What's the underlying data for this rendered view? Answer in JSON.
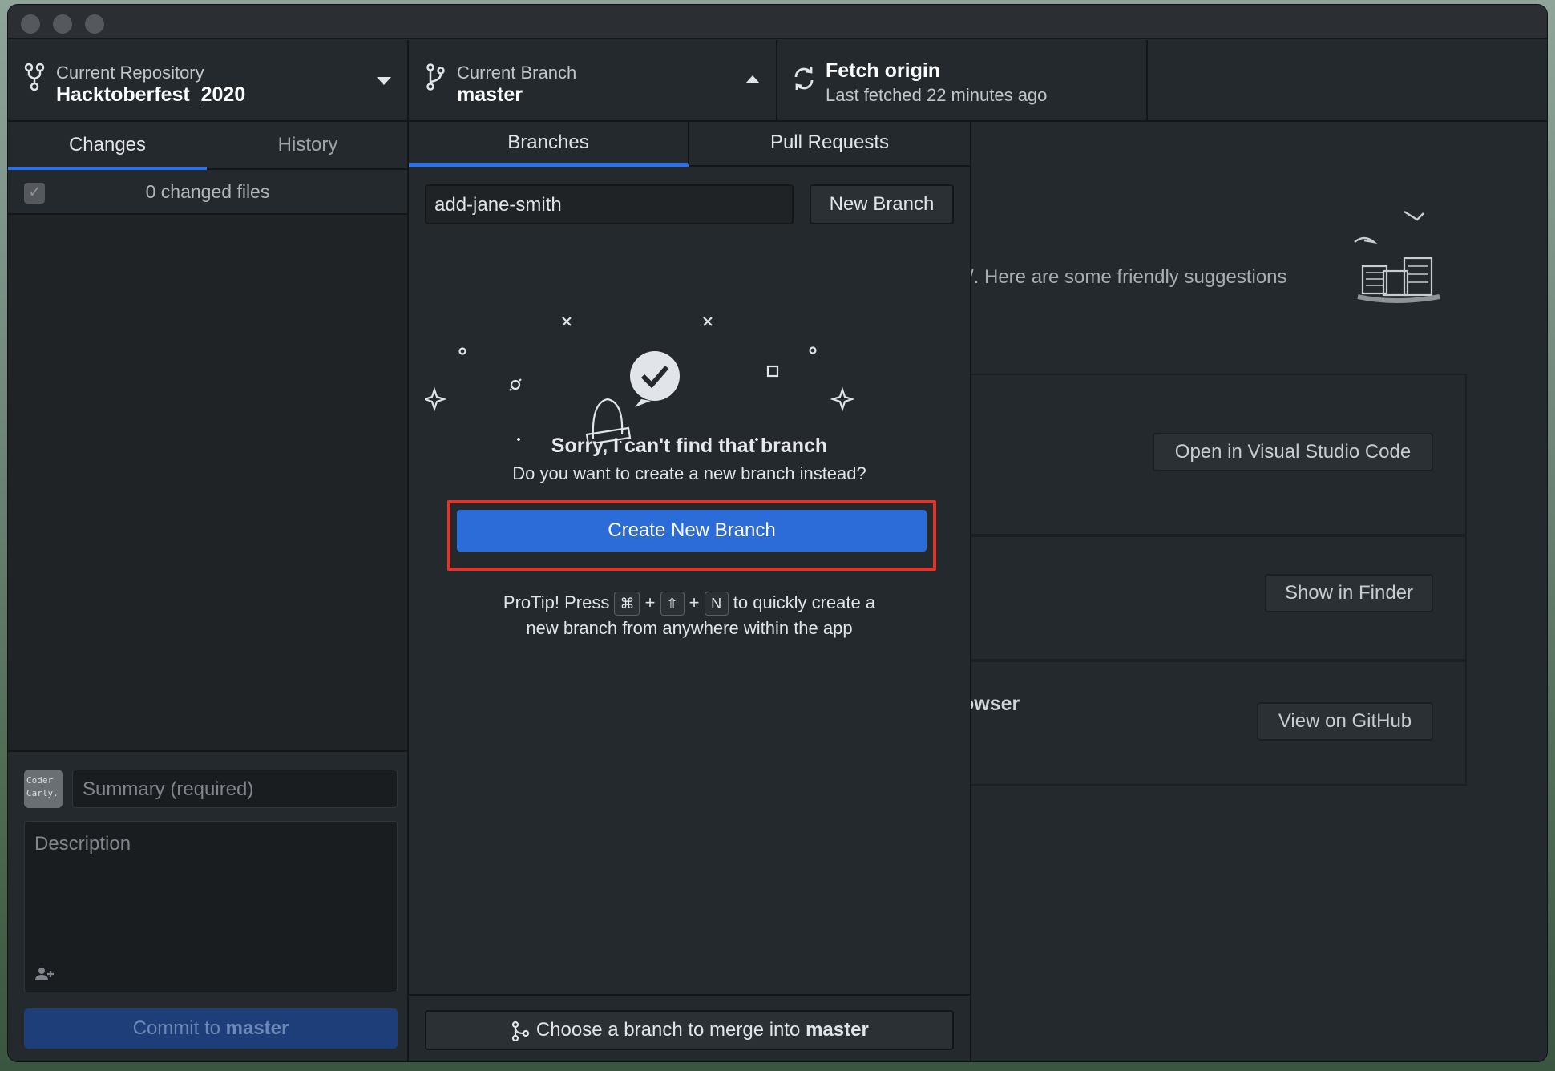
{
  "window": {
    "traffic_lights": [
      "close",
      "minimize",
      "zoom"
    ]
  },
  "toolbar": {
    "repo_label": "Current Repository",
    "repo_value": "Hacktoberfest_2020",
    "branch_label": "Current Branch",
    "branch_value": "master",
    "fetch_label": "Fetch origin",
    "fetch_value": "Last fetched 22 minutes ago",
    "icons": [
      "repo-icon",
      "branch-icon",
      "sync-icon"
    ]
  },
  "left": {
    "tabs": [
      "Changes",
      "History"
    ],
    "active_tab": "Changes",
    "changed_files": "0 changed files",
    "avatar_text": "Coder Carly",
    "summary_placeholder": "Summary (required)",
    "description_placeholder": "Description",
    "commit_prefix": "Commit to ",
    "commit_branch": "master"
  },
  "dropdown": {
    "tabs": [
      "Branches",
      "Pull Requests"
    ],
    "active_tab": "Branches",
    "filter_value": "add-jane-smith",
    "new_branch_label": "New Branch",
    "sorry_title": "Sorry, I can't find that branch",
    "sorry_sub": "Do you want to create a new branch instead?",
    "create_label": "Create New Branch",
    "protip_prefix": "ProTip! Press",
    "protip_keys": [
      "⌘",
      "⇧",
      "N"
    ],
    "protip_suffix": "to quickly create a",
    "protip_line2": "new branch from anywhere within the app",
    "merge_prefix": "Choose a branch to merge into ",
    "merge_branch": "master"
  },
  "right": {
    "friendly_text": "/. Here are some friendly suggestions",
    "open_vscode": "Open in Visual Studio Code",
    "show_finder": "Show in Finder",
    "browser_fragment": "owser",
    "view_github": "View on GitHub"
  },
  "colors": {
    "accent": "#2b6cd9",
    "tab_underline": "#2f6fe8",
    "highlight_border": "#e0352b",
    "background": "#24292e"
  }
}
